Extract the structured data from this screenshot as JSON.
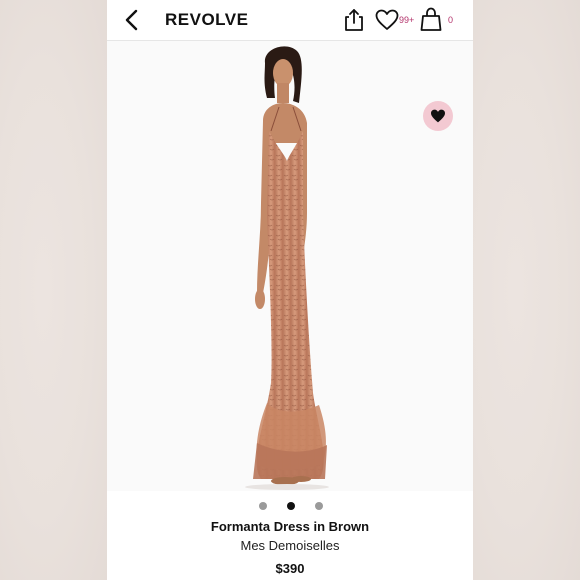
{
  "header": {
    "brand": "REVOLVE",
    "wishlist_count": "99+",
    "bag_count": "0",
    "accent_color": "#b3336b"
  },
  "gallery": {
    "image_count": 3,
    "active_index": 1,
    "favorite_color": "#f3c9d2"
  },
  "product": {
    "name": "Formanta Dress in Brown",
    "brand": "Mes Demoiselles",
    "price": "$390"
  },
  "icons": [
    "chevron-left-icon",
    "share-icon",
    "heart-outline-icon",
    "shopping-bag-icon",
    "heart-filled-icon"
  ]
}
